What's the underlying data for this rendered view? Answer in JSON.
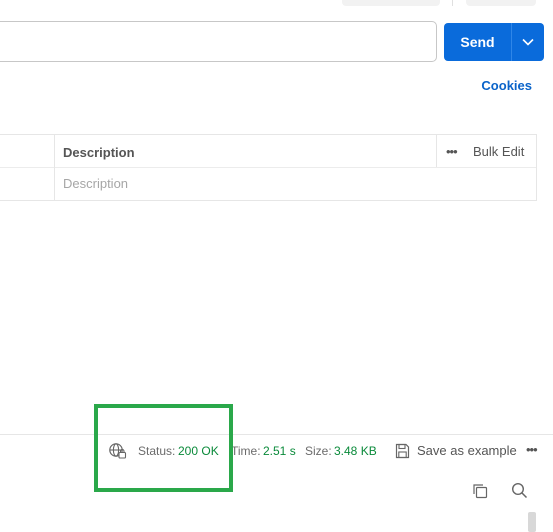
{
  "request": {
    "send_label": "Send",
    "cookies_label": "Cookies"
  },
  "params_table": {
    "description_header": "Description",
    "bulk_edit_label": "Bulk Edit",
    "more_label": "•••",
    "description_placeholder": "Description"
  },
  "response": {
    "status_label": "Status:",
    "status_value": "200 OK",
    "time_label": "Time:",
    "time_value": "2.51 s",
    "size_label": "Size:",
    "size_value": "3.48 KB",
    "save_example_label": "Save as example",
    "more_label": "•••"
  },
  "icons": {
    "globe": "globe-lock-icon",
    "save": "save-icon",
    "copy": "copy-icon",
    "search": "search-icon",
    "chevron": "chevron-down-icon"
  },
  "colors": {
    "send_button": "#0a6bdb",
    "link": "#0a63c9",
    "status_ok": "#0a8a3a",
    "highlight": "#2aa84a"
  }
}
